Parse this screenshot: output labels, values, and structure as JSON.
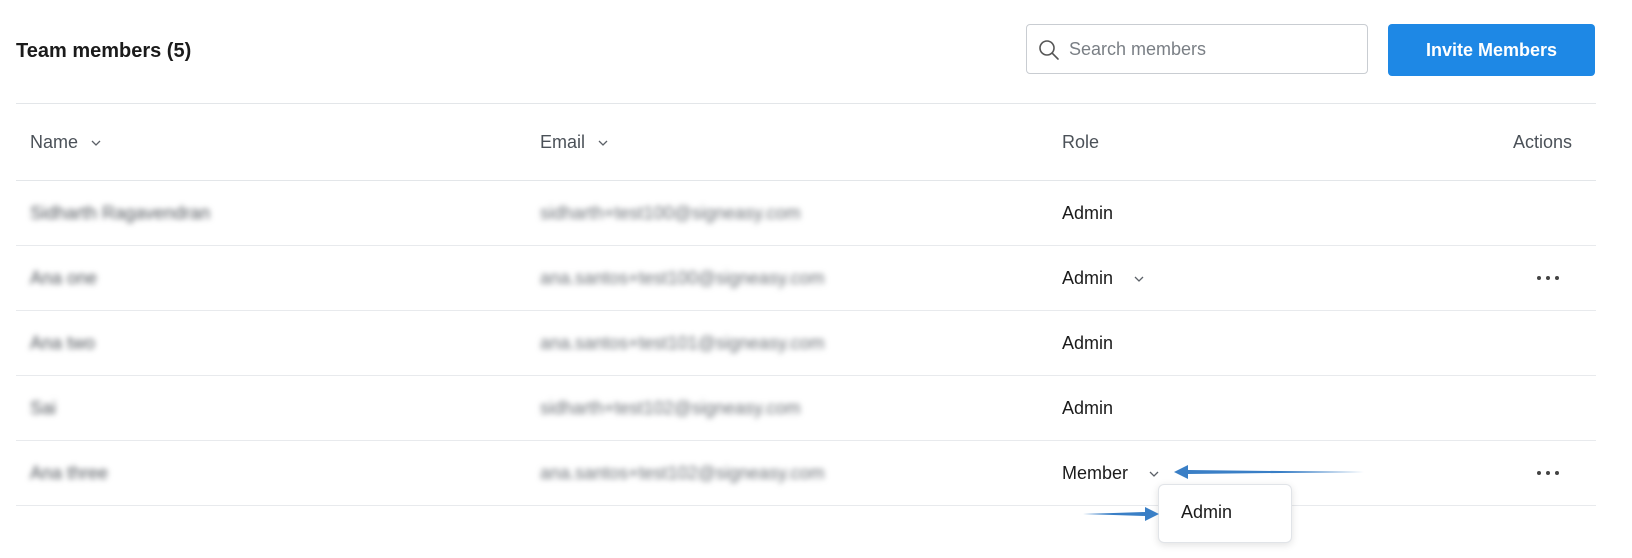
{
  "header": {
    "title": "Team members (5)",
    "search": {
      "placeholder": "Search members",
      "value": ""
    },
    "invite_label": "Invite Members"
  },
  "table": {
    "columns": [
      "Name",
      "Email",
      "Role",
      "Actions"
    ],
    "rows": [
      {
        "name": "Sidharth Ragavendran",
        "email": "sidharth+test100@signeasy.com",
        "role": "Admin"
      },
      {
        "name": "Ana one",
        "email": "ana.santos+test100@signeasy.com",
        "role": "Admin"
      },
      {
        "name": "Ana two",
        "email": "ana.santos+test101@signeasy.com",
        "role": "Admin"
      },
      {
        "name": "Sai",
        "email": "sidharth+test102@signeasy.com",
        "role": "Admin"
      },
      {
        "name": "Ana three",
        "email": "ana.santos+test102@signeasy.com",
        "role": "Member"
      }
    ]
  },
  "dropdown": {
    "options": [
      "Admin"
    ]
  },
  "colors": {
    "accent": "#1e88e5",
    "arrow": "#3a7fc6",
    "divider": "#e3e6e9"
  }
}
